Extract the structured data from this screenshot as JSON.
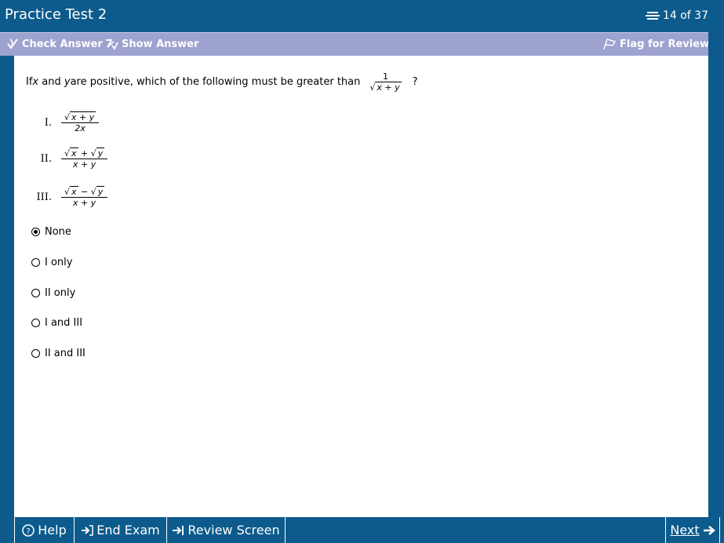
{
  "window": {
    "title": "Practice Test 2",
    "counter": "14 of 37"
  },
  "toolbar": {
    "check_answer": "Check Answer",
    "show_answer": "Show Answer",
    "flag_review": "Flag for Review"
  },
  "question": {
    "text_pre": "If ",
    "var_x": "x",
    "text_and": " and ",
    "var_y": "y",
    "text_post": " are positive, which of the following must be greater than",
    "frac_num": "1",
    "frac_den": "x + y",
    "qmark": "?"
  },
  "statements": [
    {
      "roman": "I.",
      "num": "x + y",
      "den": "2x"
    },
    {
      "roman": "II.",
      "num_a": "x",
      "op": "+",
      "num_b": "y",
      "den": "x + y"
    },
    {
      "roman": "III.",
      "num_a": "x",
      "op": "−",
      "num_b": "y",
      "den": "x + y"
    }
  ],
  "options": [
    {
      "label": "None",
      "selected": true
    },
    {
      "label": "I only",
      "selected": false
    },
    {
      "label": "II only",
      "selected": false
    },
    {
      "label": "I and III",
      "selected": false
    },
    {
      "label": "II and III",
      "selected": false
    }
  ],
  "bottom": {
    "help": "Help",
    "end_exam": "End Exam",
    "review_screen": "Review Screen",
    "next": "Next"
  }
}
